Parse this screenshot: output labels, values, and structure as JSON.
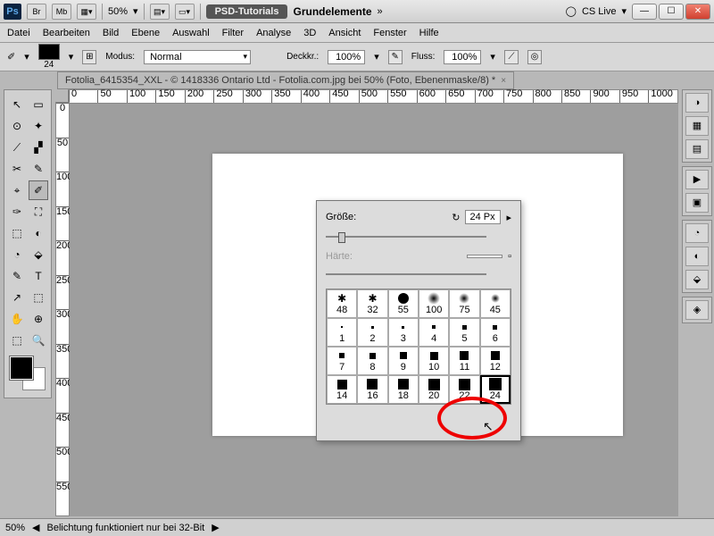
{
  "titlebar": {
    "ps": "Ps",
    "br": "Br",
    "mb": "Mb",
    "zoom": "50%",
    "tab": "PSD-Tutorials",
    "title": "Grundelemente",
    "cslive": "CS Live"
  },
  "menu": [
    "Datei",
    "Bearbeiten",
    "Bild",
    "Ebene",
    "Auswahl",
    "Filter",
    "Analyse",
    "3D",
    "Ansicht",
    "Fenster",
    "Hilfe"
  ],
  "optbar": {
    "size": "24",
    "mode_lbl": "Modus:",
    "mode_val": "Normal",
    "opacity_lbl": "Deckkr.:",
    "opacity_val": "100%",
    "flow_lbl": "Fluss:",
    "flow_val": "100%"
  },
  "doc": {
    "tab": "Fotolia_6415354_XXL - © 1418336 Ontario Ltd - Fotolia.com.jpg bei 50% (Foto, Ebenenmaske/8) *"
  },
  "ruler_h": [
    "0",
    "50",
    "100",
    "150",
    "200",
    "250",
    "300",
    "350",
    "400",
    "450",
    "500",
    "550",
    "600",
    "650",
    "700",
    "750",
    "800",
    "850",
    "900",
    "950",
    "1000"
  ],
  "ruler_v": [
    "0",
    "50",
    "100",
    "150",
    "200",
    "250",
    "300",
    "350",
    "400",
    "450",
    "500",
    "550"
  ],
  "popup": {
    "size_lbl": "Größe:",
    "size_val": "24 Px",
    "hard_lbl": "Härte:",
    "brushes": [
      {
        "n": "48",
        "t": "scatter"
      },
      {
        "n": "32",
        "t": "scatter"
      },
      {
        "n": "55",
        "t": "circ",
        "s": 12
      },
      {
        "n": "100",
        "t": "blur",
        "s": 14
      },
      {
        "n": "75",
        "t": "blur",
        "s": 12
      },
      {
        "n": "45",
        "t": "blur",
        "s": 10
      },
      {
        "n": "1",
        "t": "sq",
        "s": 2
      },
      {
        "n": "2",
        "t": "sq",
        "s": 3
      },
      {
        "n": "3",
        "t": "sq",
        "s": 3
      },
      {
        "n": "4",
        "t": "sq",
        "s": 4
      },
      {
        "n": "5",
        "t": "sq",
        "s": 5
      },
      {
        "n": "6",
        "t": "sq",
        "s": 5
      },
      {
        "n": "7",
        "t": "sq",
        "s": 6
      },
      {
        "n": "8",
        "t": "sq",
        "s": 7
      },
      {
        "n": "9",
        "t": "sq",
        "s": 8
      },
      {
        "n": "10",
        "t": "sq",
        "s": 9
      },
      {
        "n": "11",
        "t": "sq",
        "s": 10
      },
      {
        "n": "12",
        "t": "sq",
        "s": 10
      },
      {
        "n": "14",
        "t": "sq",
        "s": 11
      },
      {
        "n": "16",
        "t": "sq",
        "s": 12
      },
      {
        "n": "18",
        "t": "sq",
        "s": 12
      },
      {
        "n": "20",
        "t": "sq",
        "s": 13
      },
      {
        "n": "22",
        "t": "sq",
        "s": 13
      },
      {
        "n": "24",
        "t": "sq",
        "s": 14,
        "sel": true
      }
    ]
  },
  "status": {
    "zoom": "50%",
    "msg": "Belichtung funktioniert nur bei 32-Bit"
  },
  "tools": [
    [
      "↖",
      "▭"
    ],
    [
      "⊙",
      "✦"
    ],
    [
      "⟋",
      "▞"
    ],
    [
      "✂",
      "✎"
    ],
    [
      "⌖",
      "✐"
    ],
    [
      "✑",
      "⛶"
    ],
    [
      "⬚",
      "◐"
    ],
    [
      "◔",
      "⬙"
    ],
    [
      "✎",
      "T"
    ],
    [
      "↗",
      "⬚"
    ],
    [
      "✋",
      "⊕"
    ],
    [
      "⬚",
      "🔍"
    ]
  ]
}
